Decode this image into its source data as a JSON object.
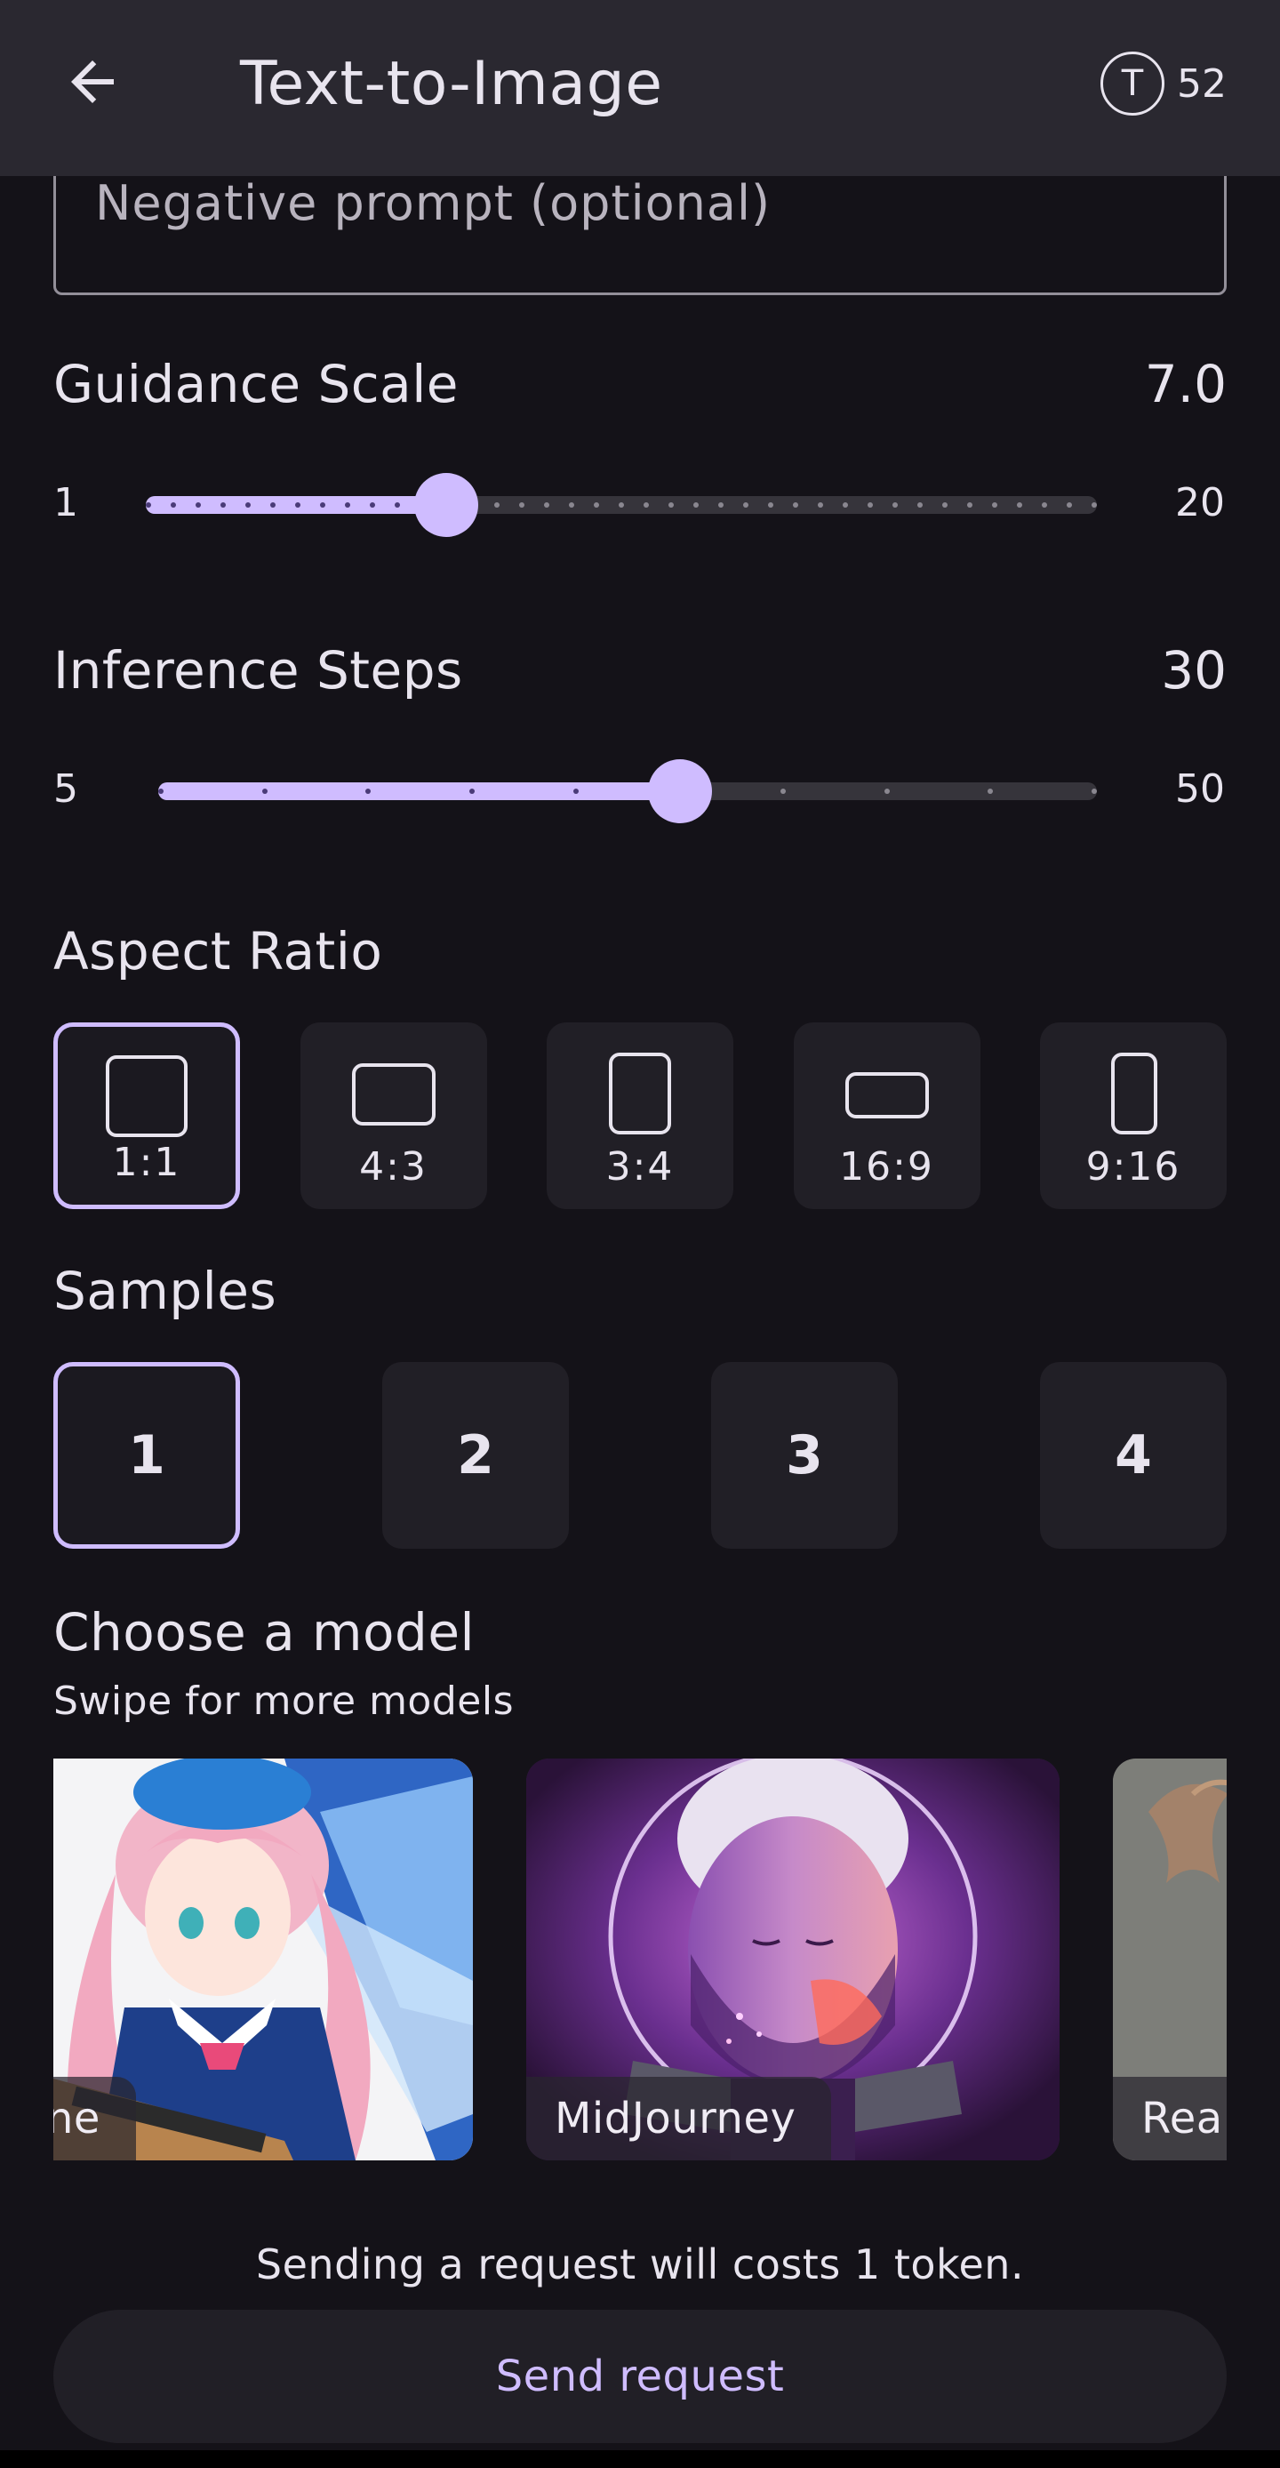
{
  "header": {
    "title": "Text-to-Image",
    "token_symbol": "T",
    "token_count": "52"
  },
  "negative_prompt": {
    "placeholder": "Negative prompt (optional)",
    "value": ""
  },
  "guidance": {
    "label": "Guidance Scale",
    "value_text": "7.0",
    "min": "1",
    "max": "20",
    "value": 7.0,
    "min_value": 1,
    "max_value": 20,
    "step": 0.5
  },
  "inference": {
    "label": "Inference Steps",
    "value_text": "30",
    "min": "5",
    "max": "50",
    "value": 30,
    "min_value": 5,
    "max_value": 50,
    "step": 5
  },
  "aspect_ratio": {
    "label": "Aspect Ratio",
    "selected": "1:1",
    "options": [
      "1:1",
      "4:3",
      "3:4",
      "16:9",
      "9:16"
    ]
  },
  "samples": {
    "label": "Samples",
    "selected": "1",
    "options": [
      "1",
      "2",
      "3",
      "4"
    ]
  },
  "models": {
    "label": "Choose a model",
    "subtitle": "Swipe for more models",
    "items": [
      {
        "name": "ne"
      },
      {
        "name": "MidJourney"
      },
      {
        "name": "Real"
      }
    ]
  },
  "footer": {
    "cost_note": "Sending a request will costs 1 token.",
    "send_label": "Send request"
  },
  "colors": {
    "accent": "#cfbcff",
    "background": "#141218",
    "surface": "#211f26",
    "appbar": "#2a2830"
  }
}
